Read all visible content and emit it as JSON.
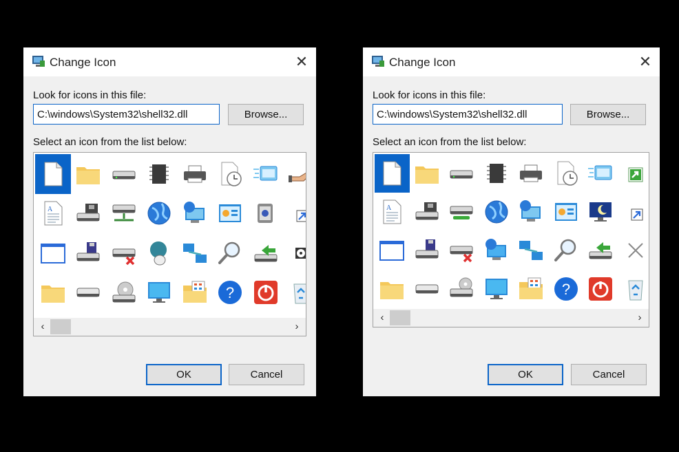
{
  "dialogs": [
    {
      "title": "Change Icon",
      "file_label": "Look for icons in this file:",
      "file_value": "C:\\windows\\System32\\shell32.dll",
      "browse_label": "Browse...",
      "list_label": "Select an icon from the list below:",
      "ok_label": "OK",
      "cancel_label": "Cancel",
      "icons": [
        [
          "blank-document-icon",
          "folder-icon",
          "hard-drive-icon",
          "memory-chip-icon",
          "printer-icon",
          "document-clock-icon",
          "window-motion-icon",
          "hand-share-icon"
        ],
        [
          "text-document-icon",
          "network-drive-icon",
          "network-server-icon",
          "globe-icon",
          "network-globe-icon",
          "control-panel-icon",
          "program-window-icon",
          "shortcut-arrow-icon"
        ],
        [
          "application-window-icon",
          "floppy-drive-icon",
          "disconnected-drive-icon",
          "globe-mouse-icon",
          "network-connections-icon",
          "magnifier-icon",
          "drive-arrow-icon",
          "small-disc-icon"
        ],
        [
          "folder-icon",
          "removable-drive-icon",
          "cd-drive-icon",
          "computer-monitor-icon",
          "control-folder-icon",
          "help-icon",
          "shutdown-icon",
          "recycle-bin-icon"
        ]
      ]
    },
    {
      "title": "Change Icon",
      "file_label": "Look for icons in this file:",
      "file_value": "C:\\windows\\System32\\shell32.dll",
      "browse_label": "Browse...",
      "list_label": "Select an icon from the list below:",
      "ok_label": "OK",
      "cancel_label": "Cancel",
      "icons": [
        [
          "blank-document-icon",
          "folder-icon",
          "hard-drive-icon",
          "memory-chip-icon",
          "printer-icon",
          "document-clock-icon",
          "window-motion-icon",
          "share-arrow-icon"
        ],
        [
          "text-document-icon",
          "network-drive-icon",
          "green-drive-icon",
          "globe-icon",
          "network-globe-icon",
          "control-panel-icon",
          "sleep-monitor-icon",
          "shortcut-arrow-icon"
        ],
        [
          "application-window-icon",
          "floppy-drive-icon",
          "disconnected-drive-icon",
          "globe-monitor-icon",
          "network-connections-icon",
          "magnifier-icon",
          "drive-arrow-icon",
          "close-x-icon"
        ],
        [
          "folder-icon",
          "removable-drive-icon",
          "disc-drive-icon",
          "computer-monitor-icon",
          "control-folder-icon",
          "help-icon",
          "shutdown-icon",
          "recycle-bin-icon"
        ]
      ]
    }
  ],
  "colors": {
    "accent": "#0a64c8",
    "dialog_bg": "#f0f0f0",
    "backdrop": "#000000"
  }
}
